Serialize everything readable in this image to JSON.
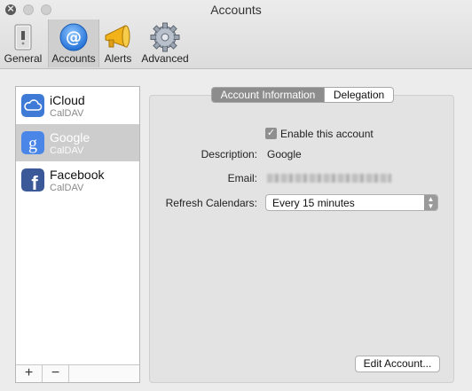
{
  "window": {
    "title": "Accounts"
  },
  "toolbar": {
    "items": [
      {
        "label": "General",
        "icon": "switch-icon"
      },
      {
        "label": "Accounts",
        "icon": "at-sign-icon",
        "selected": true
      },
      {
        "label": "Alerts",
        "icon": "megaphone-icon"
      },
      {
        "label": "Advanced",
        "icon": "gear-icon"
      }
    ]
  },
  "accounts": [
    {
      "name": "iCloud",
      "type": "CalDAV",
      "icon": "cloud-icon",
      "color": "#3e7ad6"
    },
    {
      "name": "Google",
      "type": "CalDAV",
      "icon": "google-g-icon",
      "color": "#4a86e8",
      "selected": true
    },
    {
      "name": "Facebook",
      "type": "CalDAV",
      "icon": "facebook-f-icon",
      "color": "#3b5998"
    }
  ],
  "list_footer": {
    "add_label": "+",
    "remove_label": "−"
  },
  "tabs": [
    {
      "label": "Account Information",
      "selected": true
    },
    {
      "label": "Delegation",
      "selected": false
    }
  ],
  "account_info": {
    "enable_label": "Enable this account",
    "enable_checked": true,
    "description_label": "Description:",
    "description_value": "Google",
    "email_label": "Email:",
    "refresh_label": "Refresh Calendars:",
    "refresh_value": "Every 15 minutes",
    "edit_button": "Edit Account..."
  }
}
